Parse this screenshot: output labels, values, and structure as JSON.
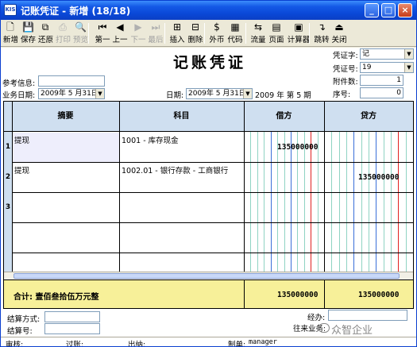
{
  "window": {
    "icon_text": "KIS",
    "title": "记账凭证 - 新增 (18/18)",
    "buttons": {
      "minimize": "_",
      "maximize": "□",
      "close": "×"
    }
  },
  "toolbar": {
    "items": [
      {
        "label": "新增",
        "icon": "new-doc-icon",
        "glyph": "🗋",
        "enabled": true
      },
      {
        "label": "保存",
        "icon": "save-icon",
        "glyph": "💾",
        "enabled": true
      },
      {
        "label": "还原",
        "icon": "restore-icon",
        "glyph": "⧉",
        "enabled": true
      },
      {
        "label": "打印",
        "icon": "print-icon",
        "glyph": "⎙",
        "enabled": false
      },
      {
        "label": "预览",
        "icon": "preview-icon",
        "glyph": "🔍",
        "enabled": false
      },
      {
        "label": "第一",
        "icon": "first-icon",
        "glyph": "⏮",
        "enabled": true
      },
      {
        "label": "上一",
        "icon": "prev-icon",
        "glyph": "◀",
        "enabled": true
      },
      {
        "label": "下一",
        "icon": "next-icon",
        "glyph": "▶",
        "enabled": false
      },
      {
        "label": "最后",
        "icon": "last-icon",
        "glyph": "⏭",
        "enabled": false
      },
      {
        "label": "插入",
        "icon": "insert-icon",
        "glyph": "⊞",
        "enabled": true
      },
      {
        "label": "删除",
        "icon": "delete-icon",
        "glyph": "⊟",
        "enabled": true
      },
      {
        "label": "外币",
        "icon": "currency-icon",
        "glyph": "$",
        "enabled": true
      },
      {
        "label": "代码",
        "icon": "code-icon",
        "glyph": "▦",
        "enabled": true
      },
      {
        "label": "流量",
        "icon": "flow-icon",
        "glyph": "⇆",
        "enabled": true
      },
      {
        "label": "页面",
        "icon": "page-icon",
        "glyph": "▤",
        "enabled": true
      },
      {
        "label": "计算器",
        "icon": "calculator-icon",
        "glyph": "▣",
        "enabled": true
      },
      {
        "label": "跳转",
        "icon": "jump-icon",
        "glyph": "↴",
        "enabled": true
      },
      {
        "label": "关闭",
        "icon": "close-icon",
        "glyph": "⏏",
        "enabled": true
      }
    ]
  },
  "form": {
    "title": "记账凭证",
    "ref_label": "参考信息:",
    "ref_value": "",
    "biz_date_label": "业务日期:",
    "biz_date_value": "2009年 5 月31日",
    "date_label": "日期:",
    "date_value": "2009年 5 月31日",
    "period_text": "2009 年 第 5 期",
    "voucher_type_label": "凭证字:",
    "voucher_type_value": "记",
    "voucher_no_label": "凭证号:",
    "voucher_no_value": "19",
    "attachments_label": "附件数:",
    "attachments_value": "1",
    "seq_label": "序号:",
    "seq_value": "0"
  },
  "grid": {
    "headers": {
      "summary": "摘要",
      "account": "科目",
      "debit": "借方",
      "credit": "贷方"
    },
    "rows": [
      {
        "no": "1",
        "summary": "提现",
        "account": "1001 - 库存现金",
        "debit": "135000000",
        "credit": ""
      },
      {
        "no": "2",
        "summary": "提现",
        "account": "1002.01 - 银行存款 - 工商银行",
        "debit": "",
        "credit": "135000000"
      },
      {
        "no": "3",
        "summary": "",
        "account": "",
        "debit": "",
        "credit": ""
      }
    ],
    "total_label": "合计: 壹佰叁拾伍万元整",
    "total_debit": "135000000",
    "total_credit": "135000000",
    "colors": {
      "header_bg": "#cfdff0",
      "total_bg": "#f7f099",
      "digit_line": "#8fd3c3",
      "red_line": "#e02020",
      "blue_line": "#3a6fd8"
    }
  },
  "footer": {
    "settle_method_label": "结算方式:",
    "settle_method_value": "",
    "settle_no_label": "结算号:",
    "settle_no_value": "",
    "handler_label": "经办:",
    "handler_value": "",
    "business_label": "往来业务:",
    "business_value": "",
    "status_items": [
      {
        "label": "审核:",
        "value": ""
      },
      {
        "label": "过账:",
        "value": ""
      },
      {
        "label": "出纳:",
        "value": ""
      },
      {
        "label": "制单:",
        "value": "manager"
      }
    ],
    "watermark": "众智企业"
  }
}
